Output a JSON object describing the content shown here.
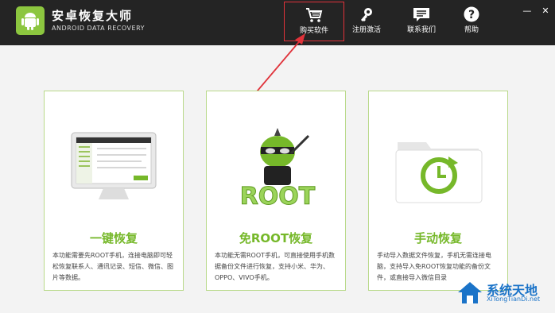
{
  "app": {
    "title": "安卓恢复大师",
    "subtitle": "ANDROID DATA RECOVERY"
  },
  "toolbar": {
    "buy": "购买软件",
    "register": "注册激活",
    "contact": "联系我们",
    "help": "帮助"
  },
  "cards": [
    {
      "title": "一键恢复",
      "desc": "本功能需要先ROOT手机，连接电脑即可轻松恢复联系人、通讯记录、短信、微信、图片等数据。"
    },
    {
      "title": "免ROOT恢复",
      "desc": "本功能无需ROOT手机，可直接使用手机数据备份文件进行恢复，支持小米、华为、OPPO、VIVO手机。"
    },
    {
      "title": "手动恢复",
      "desc": "手动导入数据文件恢复，手机无需连接电脑，支持导入免ROOT恢复功能的备份文件，或直接导入微信目录"
    }
  ],
  "root_art_text": "ROOT",
  "watermark": {
    "title": "系统天地",
    "url": "XiTongTianDi.net"
  },
  "colors": {
    "accent": "#76b82a",
    "highlight": "#e0323a",
    "titlebar": "#242424"
  }
}
